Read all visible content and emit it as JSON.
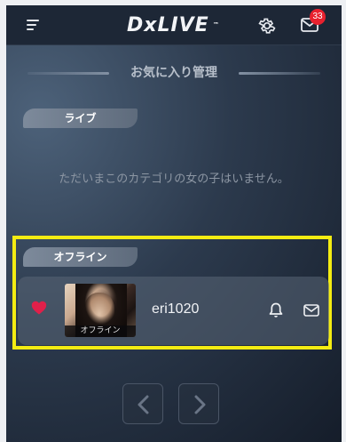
{
  "header": {
    "logo_text": "DxLIVE",
    "logo_tm": "™",
    "notification_count": "33"
  },
  "page": {
    "title": "お気に入り管理"
  },
  "sections": {
    "live": {
      "label": "ライブ",
      "empty_message": "ただいまこのカテゴリの女の子はいません。"
    },
    "offline": {
      "label": "オフライン",
      "performers": [
        {
          "name": "eri1020",
          "status": "オフライン",
          "favorited": true
        }
      ]
    }
  },
  "colors": {
    "accent_heart": "#e0204a",
    "badge": "#e8212e",
    "highlight": "#f4ec12"
  }
}
